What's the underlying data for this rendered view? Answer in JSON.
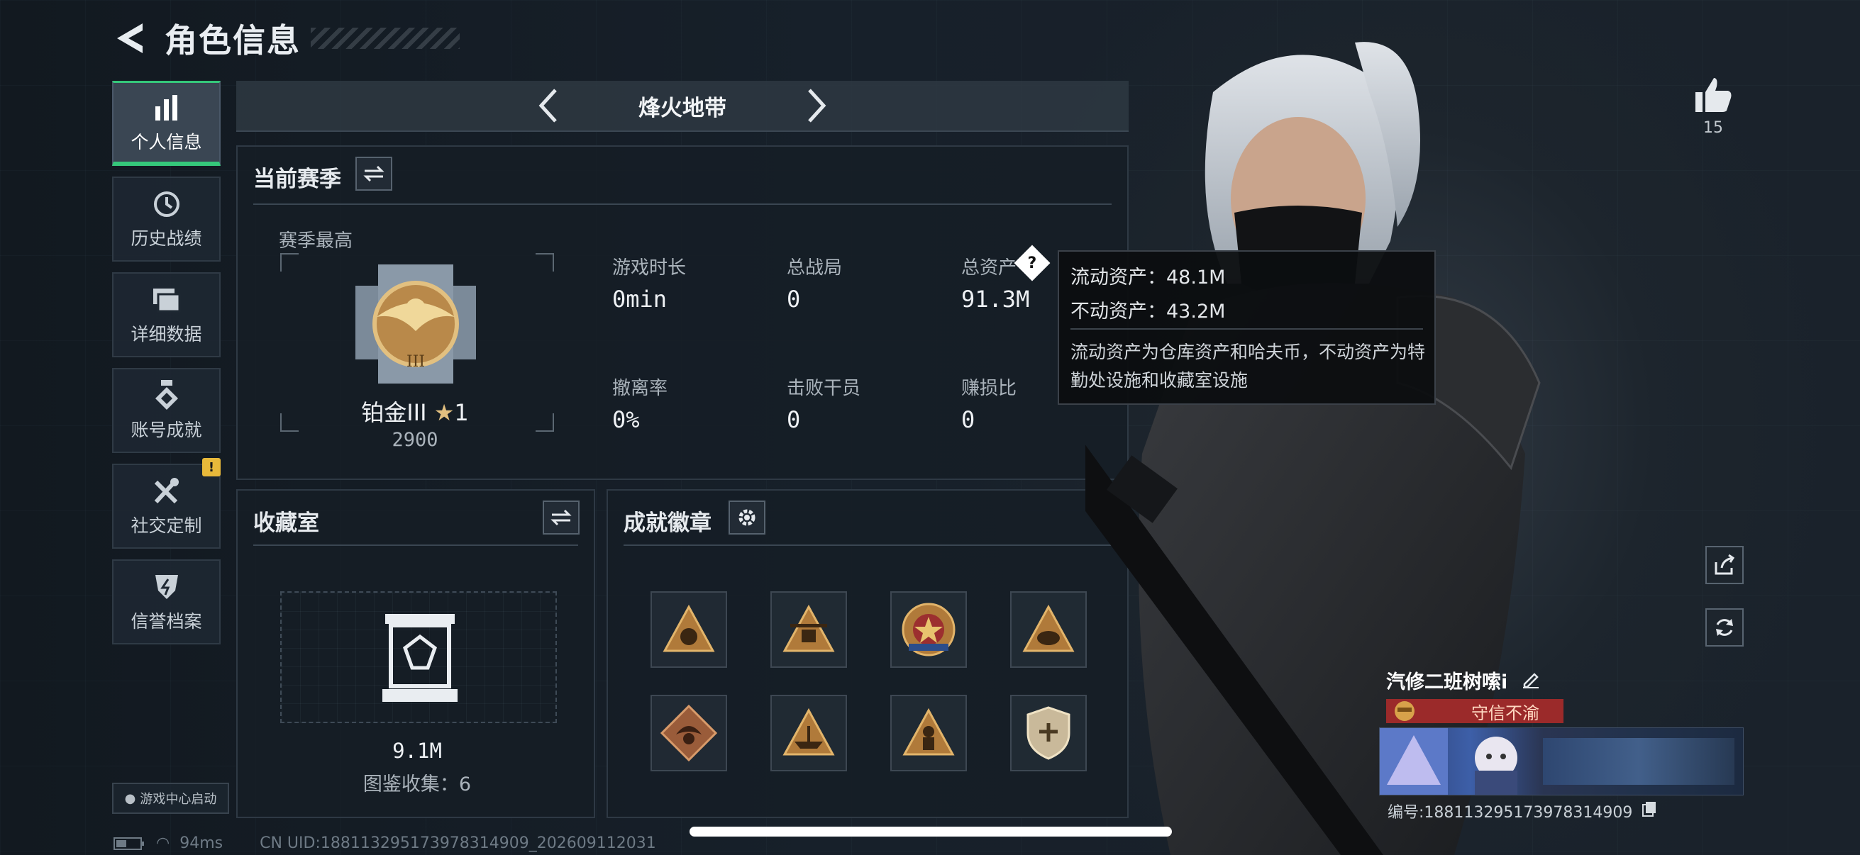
{
  "header": {
    "title": "角色信息"
  },
  "sidebar": {
    "items": [
      {
        "label": "个人信息",
        "icon": "bar-chart-icon",
        "active": true
      },
      {
        "label": "历史战绩",
        "icon": "history-icon"
      },
      {
        "label": "详细数据",
        "icon": "folders-icon"
      },
      {
        "label": "账号成就",
        "icon": "achievement-icon"
      },
      {
        "label": "社交定制",
        "icon": "tools-icon",
        "badge": "!"
      },
      {
        "label": "信誉档案",
        "icon": "credit-icon"
      }
    ],
    "launch_label": "游戏中心启动"
  },
  "mode": {
    "title": "烽火地带"
  },
  "season": {
    "title": "当前赛季",
    "best_label": "赛季最高",
    "rank_name": "铂金III",
    "stars": "1",
    "rank_score": "2900",
    "stats": [
      {
        "label": "游戏时长",
        "value": "0min"
      },
      {
        "label": "总战局",
        "value": "0"
      },
      {
        "label": "总资产",
        "value": "91.3M"
      },
      {
        "label": "撤离率",
        "value": "0%"
      },
      {
        "label": "击败干员",
        "value": "0"
      },
      {
        "label": "赚损比",
        "value": "0"
      }
    ]
  },
  "tooltip": {
    "liquid": "流动资产：48.1M",
    "fixed": "不动资产：43.2M",
    "desc": "流动资产为仓库资产和哈夫币，不动资产为特勤处设施和收藏室设施"
  },
  "collection": {
    "title": "收藏室",
    "value": "9.1M",
    "count_label": "图鉴收集：6"
  },
  "achievements": {
    "title": "成就徽章",
    "badges": [
      "badge-lion-icon",
      "badge-chopper-icon",
      "badge-star-icon",
      "badge-elephant-icon",
      "badge-dragon-icon",
      "badge-boat-icon",
      "badge-soldier-icon",
      "badge-shield-icon"
    ]
  },
  "profile": {
    "likes": "15",
    "name": "汽修二班树嗦i",
    "honor": "守信不渝",
    "uid": "编号:18811329517397831490​9"
  },
  "footer": {
    "ping": "94ms",
    "cn_uid": "CN UID:188113295173978314909_202609112031"
  },
  "colors": {
    "accent": "#35c77a",
    "honor_red": "#9b2a2a",
    "warning": "#e8b93a"
  }
}
